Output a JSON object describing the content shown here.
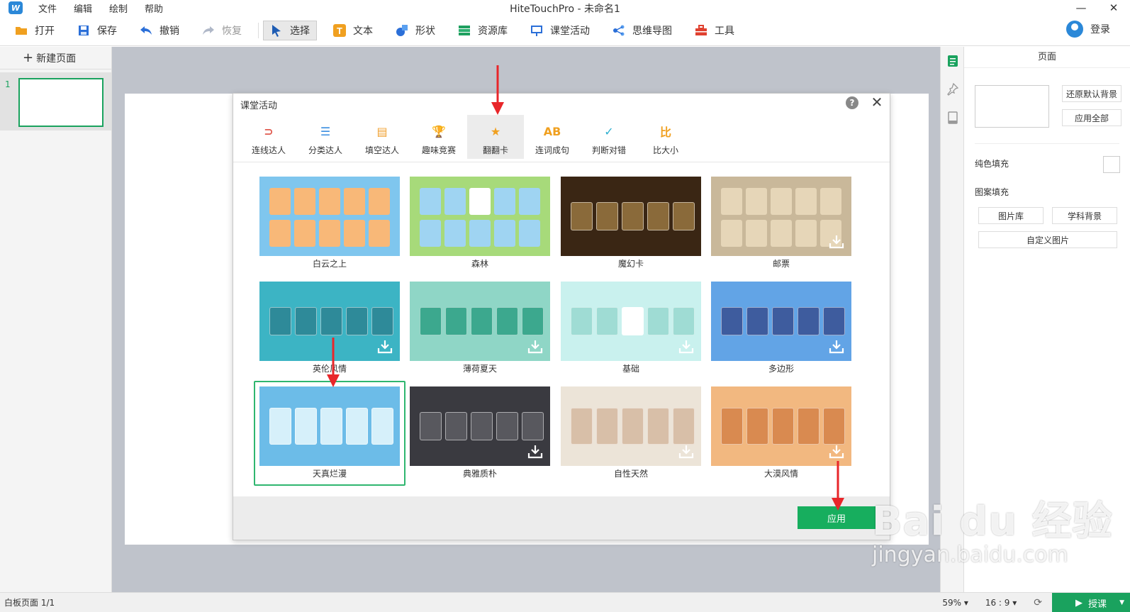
{
  "titlebar": {
    "title": "HiteTouchPro - 未命名1",
    "menus": [
      "文件",
      "编辑",
      "绘制",
      "帮助"
    ],
    "minimize": "—",
    "close": "✕"
  },
  "toolbar": {
    "open": "打开",
    "save": "保存",
    "undo": "撤销",
    "redo": "恢复",
    "select": "选择",
    "text": "文本",
    "shape": "形状",
    "resources": "资源库",
    "class_activity": "课堂活动",
    "mindmap": "思维导图",
    "tools": "工具",
    "login": "登录"
  },
  "left_panel": {
    "new_page": "新建页面",
    "page_number": "1"
  },
  "right_panel": {
    "title": "页面",
    "restore_bg": "还原默认背景",
    "apply_all": "应用全部",
    "solid_fill": "纯色填充",
    "pattern_fill": "图案填充",
    "gallery": "图片库",
    "subject_bg": "学科背景",
    "custom_image": "自定义图片"
  },
  "statusbar": {
    "page_info": "白板页面 1/1",
    "zoom": "59%",
    "ratio": "16 : 9",
    "teach": "授课"
  },
  "dialog": {
    "title": "课堂活动",
    "help": "?",
    "close": "✕",
    "tabs": [
      {
        "label": "连线达人",
        "icon": "link-icon",
        "color": "#e05a4f"
      },
      {
        "label": "分类达人",
        "icon": "list-icon",
        "color": "#3a8ee0"
      },
      {
        "label": "填空达人",
        "icon": "fill-blank-icon",
        "color": "#f0a030"
      },
      {
        "label": "趣味竞赛",
        "icon": "trophy-icon",
        "color": "#20b0a0"
      },
      {
        "label": "翻翻卡",
        "icon": "flip-card-icon",
        "color": "#f0a020"
      },
      {
        "label": "连词成句",
        "icon": "word-link-icon",
        "color": "#f0a020"
      },
      {
        "label": "判断对错",
        "icon": "true-false-icon",
        "color": "#30b0d0"
      },
      {
        "label": "比大小",
        "icon": "compare-icon",
        "color": "#f0a020"
      }
    ],
    "templates": [
      {
        "label": "白云之上",
        "bg": "#7fc6ee",
        "card": "#f8b878",
        "light": true
      },
      {
        "label": "森林",
        "bg": "#a7da7a",
        "card": "#9fd4f2",
        "light": true
      },
      {
        "label": "魔幻卡",
        "bg": "#3a2614",
        "card": "#8a6a3a",
        "light": false
      },
      {
        "label": "邮票",
        "bg": "#c9b89a",
        "card": "#e6d6b8",
        "light": true
      },
      {
        "label": "英伦风情",
        "bg": "#3cb4c4",
        "card": "#2e8a99",
        "light": false
      },
      {
        "label": "薄荷夏天",
        "bg": "#8fd6c6",
        "card": "#3ca88e",
        "light": false
      },
      {
        "label": "基础",
        "bg": "#c9f1ee",
        "card": "#9fdcd4",
        "light": true
      },
      {
        "label": "多边形",
        "bg": "#62a4e6",
        "card": "#3e5c9e",
        "light": false
      },
      {
        "label": "天真烂漫",
        "bg": "#6cbce8",
        "card": "#d6f0fa",
        "light": true
      },
      {
        "label": "典雅质朴",
        "bg": "#3a3a40",
        "card": "#58585e",
        "light": false
      },
      {
        "label": "自性天然",
        "bg": "#ece4d8",
        "card": "#d8bfa8",
        "light": true
      },
      {
        "label": "大漠风情",
        "bg": "#f2b880",
        "card": "#d98a50",
        "light": true
      }
    ],
    "apply": "应用"
  },
  "watermark": {
    "main": "Bai du 经验",
    "sub": "jingyan.baidu.com"
  },
  "colors": {
    "accent_green": "#17ae5e",
    "annotation_red": "#e8262a"
  }
}
